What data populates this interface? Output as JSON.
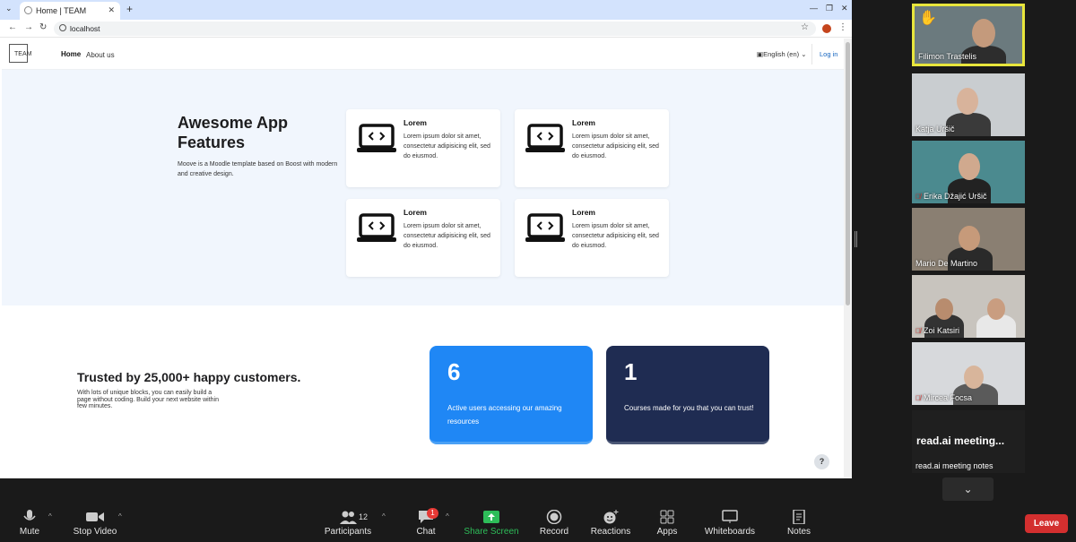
{
  "browser": {
    "tab_title": "Home | TEAM",
    "address": "localhost"
  },
  "site": {
    "logo_text": "TEAM",
    "nav": {
      "home": "Home",
      "about": "About us"
    },
    "language": "English (en)",
    "login": "Log in",
    "features": {
      "title": "Awesome App Features",
      "description": "Moove is a Moodle template based on Boost with modern and creative design.",
      "cards": [
        {
          "title": "Lorem",
          "text": "Lorem ipsum dolor sit amet, consectetur adipisicing elit, sed do eiusmod."
        },
        {
          "title": "Lorem",
          "text": "Lorem ipsum dolor sit amet, consectetur adipisicing elit, sed do eiusmod."
        },
        {
          "title": "Lorem",
          "text": "Lorem ipsum dolor sit amet, consectetur adipisicing elit, sed do eiusmod."
        },
        {
          "title": "Lorem",
          "text": "Lorem ipsum dolor sit amet, consectetur adipisicing elit, sed do eiusmod."
        }
      ]
    },
    "trust": {
      "title": "Trusted by 25,000+ happy customers.",
      "description": "With lots of unique blocks, you can easily build a page without coding. Build your next website within few minutes.",
      "stats": [
        {
          "number": "6",
          "text": "Active users accessing our amazing resources",
          "color": "#1f87f5"
        },
        {
          "number": "1",
          "text": "Courses made for you that you can trust!",
          "color": "#1f2c52"
        }
      ]
    },
    "help": "?"
  },
  "participants": [
    {
      "name": "Filimon Trastelis",
      "muted": false,
      "active": true,
      "raised_hand": true
    },
    {
      "name": "Katja Uršič",
      "muted": false
    },
    {
      "name": "Erika Džajić Uršič",
      "muted": true
    },
    {
      "name": "Mario De Martino",
      "muted": false
    },
    {
      "name": "Zoi Katsiri",
      "muted": true
    },
    {
      "name": "Mircea Focsa",
      "muted": true
    }
  ],
  "readai": {
    "title": "read.ai meeting...",
    "name": "read.ai meeting notes"
  },
  "toolbar": {
    "mute": "Mute",
    "stop_video": "Stop Video",
    "participants": "Participants",
    "participant_count": "12",
    "chat": "Chat",
    "chat_badge": "1",
    "share_screen": "Share Screen",
    "record": "Record",
    "reactions": "Reactions",
    "apps": "Apps",
    "whiteboards": "Whiteboards",
    "notes": "Notes",
    "leave": "Leave"
  },
  "colors": {
    "share_screen": "#2ebd59",
    "leave": "#d32f2f",
    "active_speaker": "#e8e63c"
  }
}
